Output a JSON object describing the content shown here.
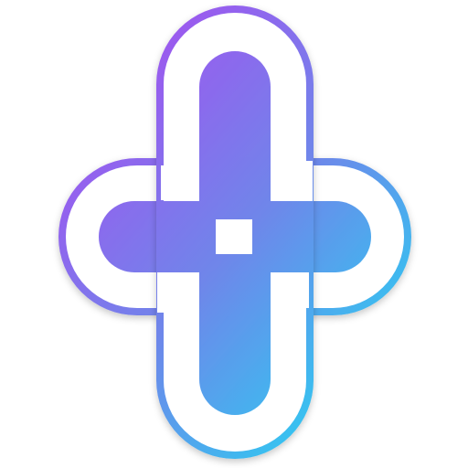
{
  "icon": {
    "name": "interlaced-cross-knot-logo",
    "background": "#ffffff",
    "gradient": {
      "start": "#a64ff0",
      "mid": "#6f86ea",
      "end": "#22d8f2"
    },
    "outline_color": "#ffffff"
  }
}
